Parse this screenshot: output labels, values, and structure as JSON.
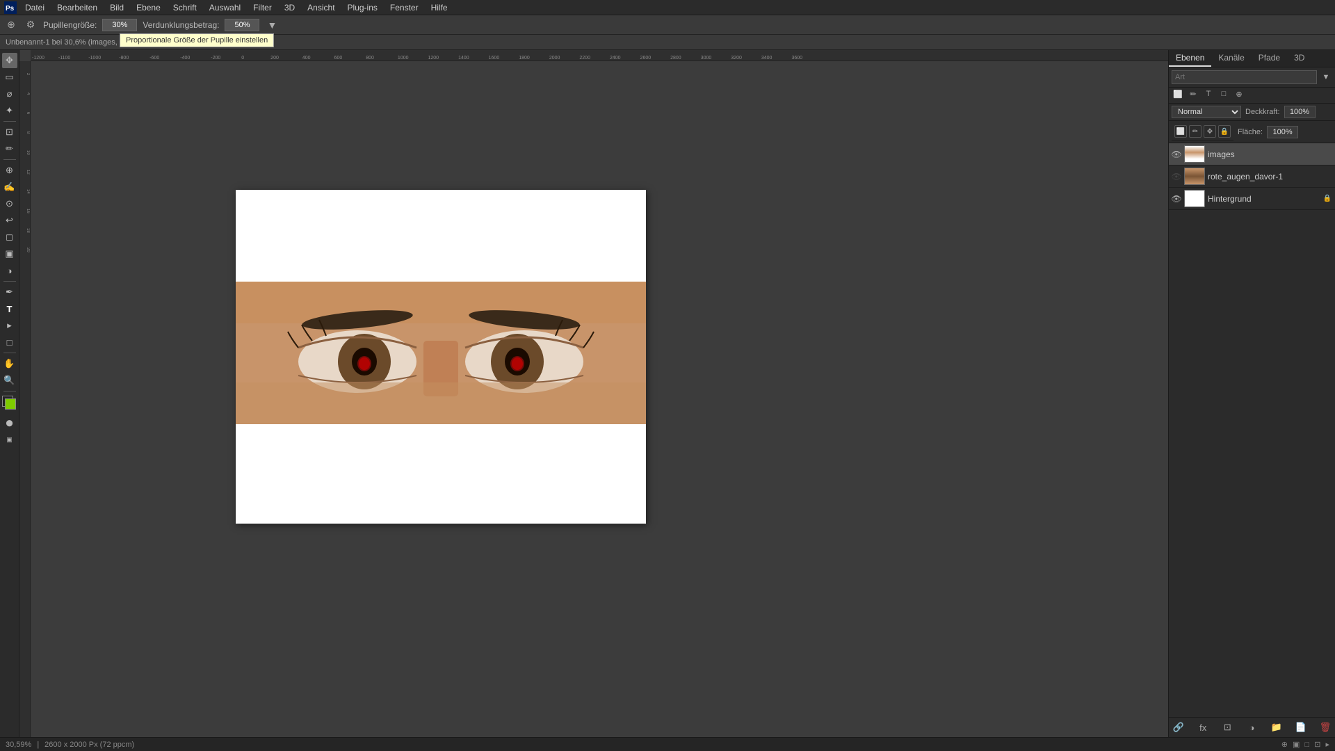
{
  "menubar": {
    "items": [
      "Datei",
      "Bearbeiten",
      "Bild",
      "Ebene",
      "Schrift",
      "Auswahl",
      "Filter",
      "3D",
      "Ansicht",
      "Plug-ins",
      "Fenster",
      "Hilfe"
    ]
  },
  "optionsbar": {
    "pupil_label": "Pupillengröße:",
    "pupil_value": "30%",
    "darken_label": "Verdunklungsbetrag:",
    "darken_value": "50%",
    "tooltip": "Proportionale Größe der Pupille einstellen"
  },
  "infobar": {
    "text": "Unbenannt-1 bei 30,6% (images, R"
  },
  "canvas": {
    "title": "Unbenannt-1"
  },
  "ruler": {
    "h_marks": [
      "-1200",
      "-1100",
      "-1000",
      "-800",
      "-600",
      "-400",
      "-200",
      "0",
      "200",
      "400",
      "600",
      "800",
      "1000",
      "1200",
      "1400",
      "1600",
      "1800",
      "2000",
      "2200",
      "2400",
      "2600",
      "2800",
      "3000",
      "3200",
      "3400",
      "3600"
    ],
    "v_marks": [
      "2",
      "4",
      "6",
      "8",
      "10",
      "12",
      "14",
      "16",
      "18",
      "20"
    ]
  },
  "right_panel": {
    "tabs": [
      "Ebenen",
      "Kanäle",
      "Pfade",
      "3D"
    ],
    "active_tab": "Ebenen",
    "search_placeholder": "Art",
    "blend_mode": "Normal",
    "opacity_label": "Deckkraft:",
    "opacity_value": "100%",
    "fill_label": "Fläche:",
    "fill_value": "100%",
    "layers": [
      {
        "name": "images",
        "visible": true,
        "active": true,
        "locked": false,
        "has_thumb": true,
        "thumb_type": "images"
      },
      {
        "name": "rote_augen_davor-1",
        "visible": false,
        "active": false,
        "locked": false,
        "has_thumb": true,
        "thumb_type": "eyes"
      },
      {
        "name": "Hintergrund",
        "visible": true,
        "active": false,
        "locked": true,
        "has_thumb": true,
        "thumb_type": "white"
      }
    ]
  },
  "statusbar": {
    "zoom": "30,59%",
    "dimensions": "2600 x 2000 Px (72 ppcm)"
  },
  "tools": [
    {
      "name": "move",
      "icon": "✥"
    },
    {
      "name": "marquee-rect",
      "icon": "⬜"
    },
    {
      "name": "lasso",
      "icon": "⌀"
    },
    {
      "name": "magic-wand",
      "icon": "✦"
    },
    {
      "name": "crop",
      "icon": "⊡"
    },
    {
      "name": "eyedropper",
      "icon": "✏"
    },
    {
      "name": "spot-healing",
      "icon": "⊕"
    },
    {
      "name": "brush",
      "icon": "✍"
    },
    {
      "name": "clone-stamp",
      "icon": "⊙"
    },
    {
      "name": "history-brush",
      "icon": "↩"
    },
    {
      "name": "eraser",
      "icon": "◻"
    },
    {
      "name": "gradient",
      "icon": "▣"
    },
    {
      "name": "dodge",
      "icon": "◑"
    },
    {
      "name": "pen",
      "icon": "✒"
    },
    {
      "name": "type",
      "icon": "T"
    },
    {
      "name": "path-select",
      "icon": "▸"
    },
    {
      "name": "shape",
      "icon": "□"
    },
    {
      "name": "hand",
      "icon": "☛"
    },
    {
      "name": "zoom",
      "icon": "⊕"
    }
  ]
}
